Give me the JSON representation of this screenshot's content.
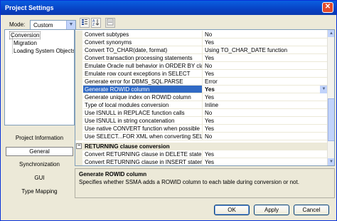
{
  "window": {
    "title": "Project Settings",
    "close_glyph": "✕"
  },
  "mode": {
    "label": "Mode:",
    "value": "Custom",
    "arrow": "▼"
  },
  "tree": {
    "items": [
      "Conversion",
      "Migration",
      "Loading System Objects"
    ]
  },
  "nav": {
    "project_information": "Project Information",
    "general": "General",
    "synchronization": "Synchronization",
    "gui": "GUI",
    "type_mapping": "Type Mapping"
  },
  "toolbar": {
    "categorized_icon": "categorized-icon",
    "alphabetical_icon": "sort-az-icon",
    "pages_icon": "property-pages-icon"
  },
  "grid": {
    "rows": [
      {
        "name": "Convert subtypes",
        "value": "No"
      },
      {
        "name": "Convert synonyms",
        "value": "Yes"
      },
      {
        "name": "Convert TO_CHAR(date, format)",
        "value": "Using TO_CHAR_DATE function"
      },
      {
        "name": "Convert transaction processing statements",
        "value": "Yes"
      },
      {
        "name": "Emulate Oracle null behavior in ORDER BY clause",
        "value": "No"
      },
      {
        "name": "Emulate row count exceptions in SELECT",
        "value": "Yes"
      },
      {
        "name": "Generate error for DBMS_SQL.PARSE",
        "value": "Error"
      },
      {
        "name": "Generate ROWID column",
        "value": "Yes"
      },
      {
        "name": "Generate unique index on ROWID column",
        "value": "Yes"
      },
      {
        "name": "Type of local modules conversion",
        "value": "Inline"
      },
      {
        "name": "Use ISNULL in REPLACE function calls",
        "value": "No"
      },
      {
        "name": "Use ISNULL in string concatenation",
        "value": "Yes"
      },
      {
        "name": "Use native CONVERT function when possible",
        "value": "Yes"
      },
      {
        "name": "Use SELECT...FOR XML when converting SELECT",
        "value": "No"
      }
    ],
    "selected_index": 7,
    "category": {
      "toggle": "−",
      "label": "RETURNING clause conversion"
    },
    "category_rows": [
      {
        "name": "Convert RETURNING clause in DELETE statement",
        "value": "Yes"
      },
      {
        "name": "Convert RETURNING clause in INSERT statement",
        "value": "Yes"
      }
    ]
  },
  "description": {
    "title": "Generate ROWID column",
    "text": "Specifies whether SSMA adds a ROWID column to each table during conversion or not."
  },
  "buttons": {
    "ok": "OK",
    "apply": "Apply",
    "cancel": "Cancel"
  }
}
